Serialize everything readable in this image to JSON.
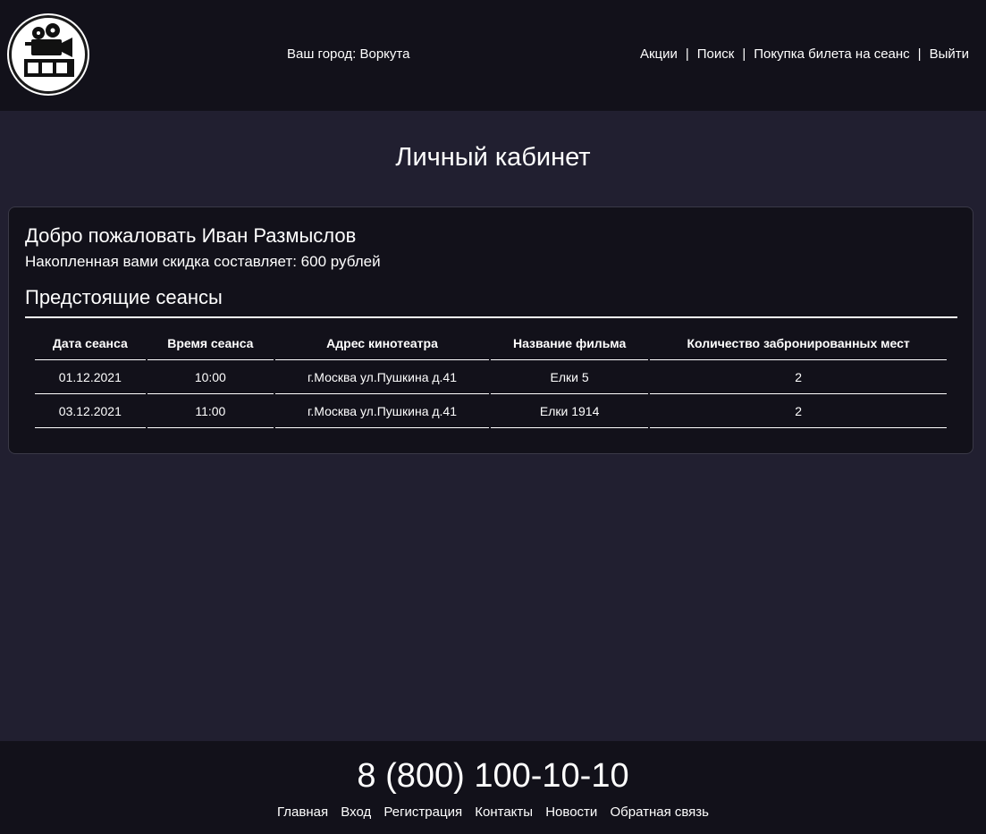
{
  "header": {
    "city_text": "Ваш город: Воркута",
    "nav": [
      {
        "label": "Акции"
      },
      {
        "label": "Поиск"
      },
      {
        "label": "Покупка билета на сеанс"
      },
      {
        "label": "Выйти"
      }
    ],
    "nav_separator": "|"
  },
  "page_title": "Личный кабинет",
  "account": {
    "welcome": "Добро пожаловать Иван Размыслов",
    "discount": "Накопленная вами скидка составляет: 600 рублей",
    "upcoming_title": "Предстоящие сеансы",
    "table": {
      "headers": [
        "Дата сеанса",
        "Время сеанса",
        "Адрес кинотеатра",
        "Название фильма",
        "Количество забронированных мест"
      ],
      "rows": [
        [
          "01.12.2021",
          "10:00",
          "г.Москва ул.Пушкина д.41",
          "Елки 5",
          "2"
        ],
        [
          "03.12.2021",
          "11:00",
          "г.Москва ул.Пушкина д.41",
          "Елки 1914",
          "2"
        ]
      ]
    }
  },
  "footer": {
    "phone": "8 (800) 100-10-10",
    "links": [
      {
        "label": "Главная"
      },
      {
        "label": "Вход"
      },
      {
        "label": "Регистрация"
      },
      {
        "label": "Контакты"
      },
      {
        "label": "Новости"
      },
      {
        "label": "Обратная связь"
      }
    ]
  },
  "colors": {
    "background": "#211f30",
    "header_footer": "#12111a",
    "text": "#ffffff"
  },
  "icons": {
    "logo": "film-camera-icon"
  }
}
